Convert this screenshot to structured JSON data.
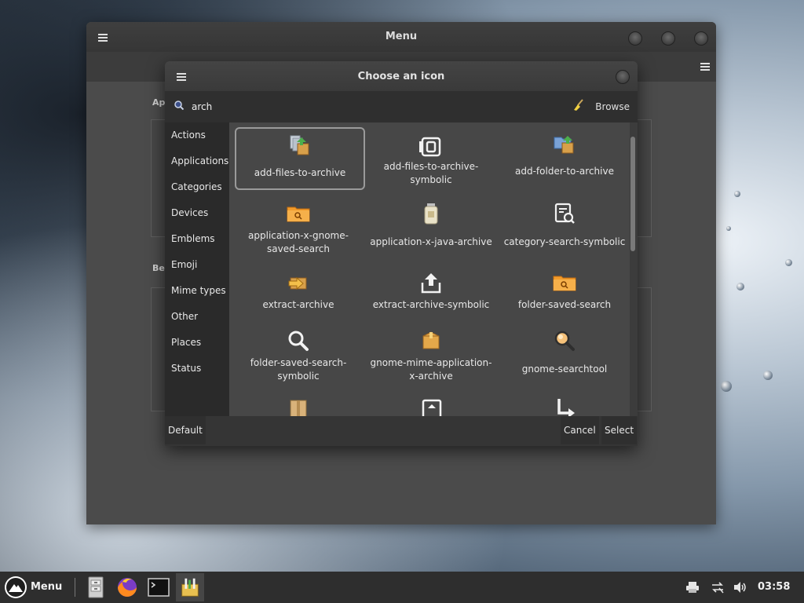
{
  "main_window": {
    "title": "Menu",
    "section_label_1": "Ap",
    "section_label_2": "Be"
  },
  "dialog": {
    "title": "Choose an icon",
    "search": {
      "value": "arch",
      "placeholder": ""
    },
    "browse_label": "Browse",
    "categories": [
      "Actions",
      "Applications",
      "Categories",
      "Devices",
      "Emblems",
      "Emoji",
      "Mime types",
      "Other",
      "Places",
      "Status"
    ],
    "icons": [
      {
        "name": "add-files-to-archive",
        "icon": "archive-add-files-icon",
        "selected": true
      },
      {
        "name": "add-files-to-archive-symbolic",
        "icon": "archive-symbolic-icon",
        "selected": false
      },
      {
        "name": "add-folder-to-archive",
        "icon": "folder-archive-icon",
        "selected": false
      },
      {
        "name": "application-x-gnome-saved-search",
        "icon": "saved-search-folder-icon",
        "selected": false
      },
      {
        "name": "application-x-java-archive",
        "icon": "java-jar-icon",
        "selected": false
      },
      {
        "name": "category-search-symbolic",
        "icon": "document-search-icon",
        "selected": false
      },
      {
        "name": "extract-archive",
        "icon": "extract-archive-icon",
        "selected": false
      },
      {
        "name": "extract-archive-symbolic",
        "icon": "share-up-icon",
        "selected": false
      },
      {
        "name": "folder-saved-search",
        "icon": "saved-search-folder-icon",
        "selected": false
      },
      {
        "name": "folder-saved-search-symbolic",
        "icon": "magnifier-icon",
        "selected": false
      },
      {
        "name": "gnome-mime-application-x-archive",
        "icon": "package-icon",
        "selected": false
      },
      {
        "name": "gnome-searchtool",
        "icon": "magnifier-orange-icon",
        "selected": false
      }
    ],
    "default_label": "Default",
    "cancel_label": "Cancel",
    "select_label": "Select"
  },
  "taskbar": {
    "menu_label": "Menu",
    "clock": "03:58"
  },
  "colors": {
    "accent_orange": "#f0a030",
    "dialog_bg": "#3c3c3c",
    "grid_bg": "#474747",
    "sidebar_bg": "#2a2a2a"
  }
}
